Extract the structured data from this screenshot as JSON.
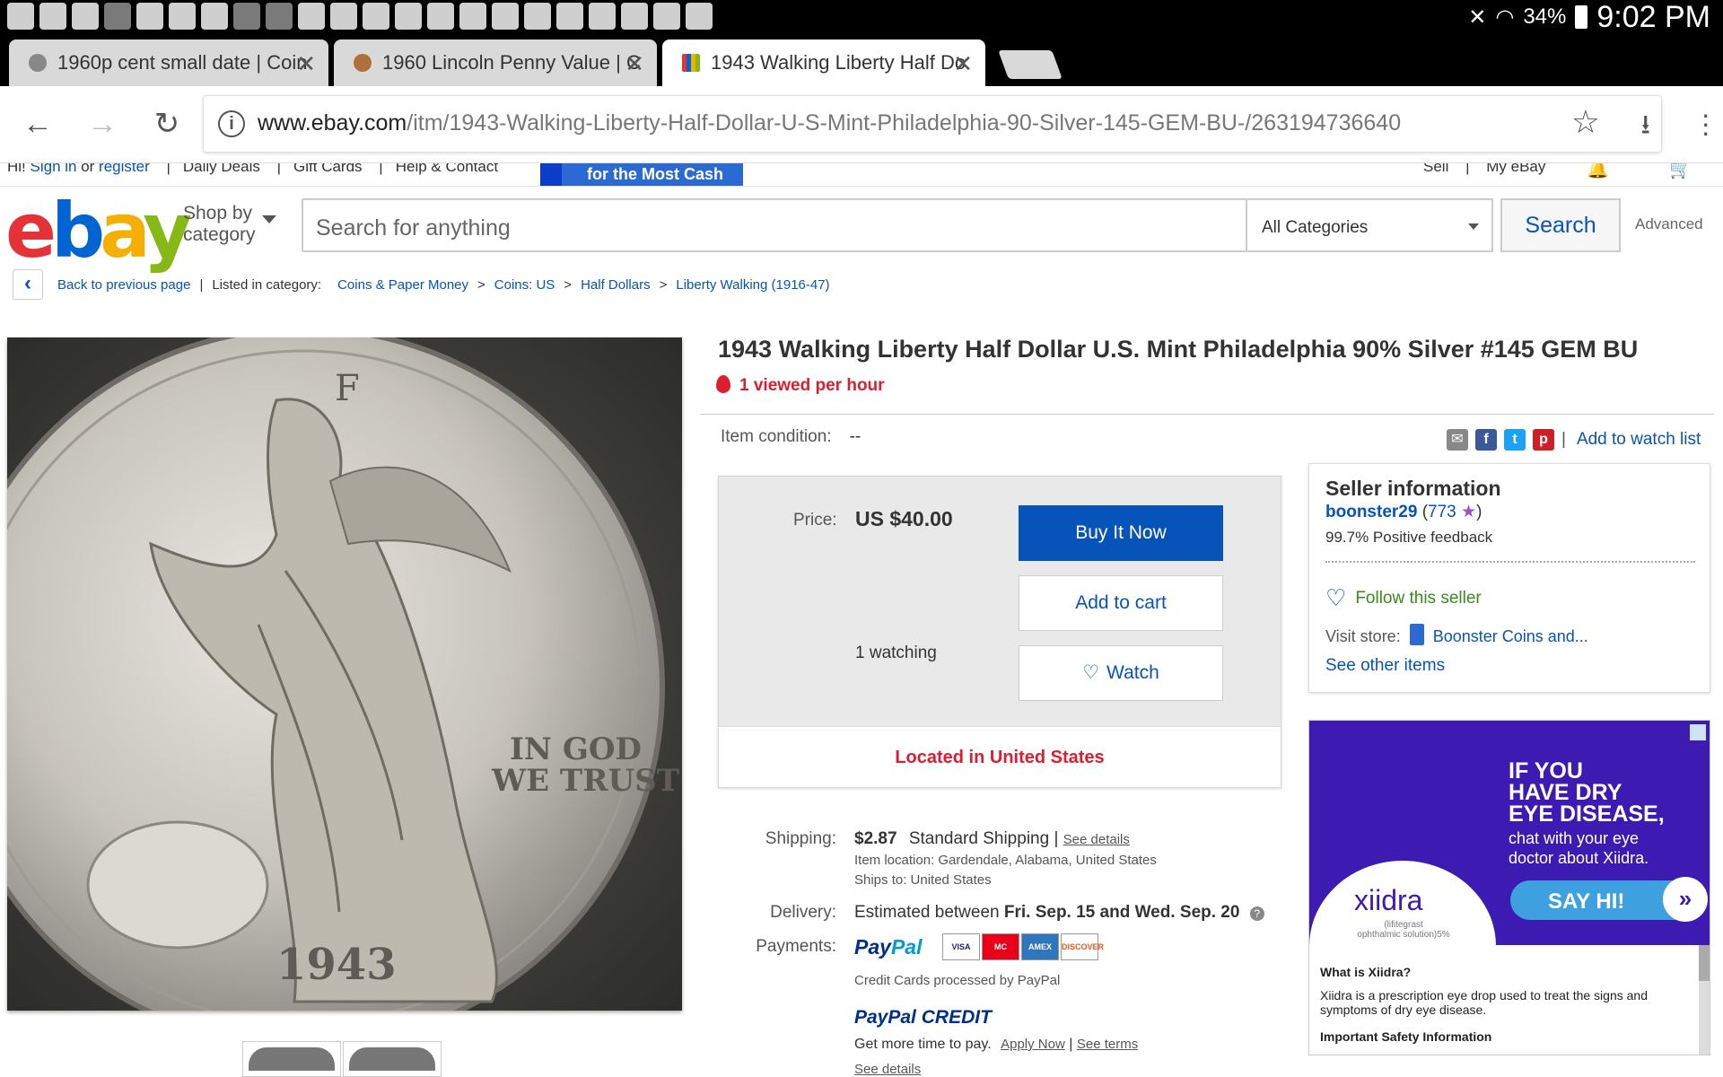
{
  "status_bar": {
    "battery": "34%",
    "time": "9:02 PM"
  },
  "tabs": [
    {
      "title": "1960p cent small date | Coin"
    },
    {
      "title": "1960 Lincoln Penny Value | C"
    },
    {
      "title": "1943 Walking Liberty Half Do"
    }
  ],
  "toolbar": {
    "url_host": "www.ebay.com",
    "url_path": "/itm/1943-Walking-Liberty-Half-Dollar-U-S-Mint-Philadelphia-90-Silver-145-GEM-BU-/263194736640"
  },
  "ebay_nav": {
    "greeting": "Hi! ",
    "sign_in": "Sign in",
    "or": " or ",
    "register": "register",
    "daily_deals": "Daily Deals",
    "gift_cards": "Gift Cards",
    "help": "Help & Contact",
    "promo": "for the Most Cash",
    "sell": "Sell",
    "my_ebay": "My eBay"
  },
  "header": {
    "logo": {
      "e": "e",
      "b": "b",
      "a": "a",
      "y": "y"
    },
    "shop_by_1": "Shop by",
    "shop_by_2": "category",
    "search_placeholder": "Search for anything",
    "category": "All Categories",
    "search_button": "Search",
    "advanced": "Advanced"
  },
  "breadcrumb": {
    "back": "Back to previous page",
    "listed": "Listed in category:",
    "items": [
      "Coins & Paper Money",
      "Coins: US",
      "Half Dollars",
      "Liberty Walking (1916-47)"
    ]
  },
  "coin": {
    "date": "1943",
    "motto_1": "IN GOD",
    "motto_2": "WE TRUST",
    "mint_mark": "F"
  },
  "item": {
    "title": "1943 Walking Liberty Half Dollar U.S. Mint Philadelphia 90% Silver #145 GEM BU",
    "viewed": "1 viewed per hour",
    "condition_label": "Item condition:",
    "condition_value": "--",
    "add_to_watch": "Add to watch list"
  },
  "buy_box": {
    "price_label": "Price:",
    "price": "US $40.00",
    "buy_now": "Buy It Now",
    "add_to_cart": "Add to cart",
    "watching": "1 watching",
    "watch": "Watch",
    "location": "Located in United States"
  },
  "shipping": {
    "label": "Shipping:",
    "cost": "$2.87",
    "method": "Standard Shipping",
    "details": "See details",
    "item_location": "Item location:  Gardendale, Alabama, United States",
    "ships_to": "Ships to:  United States"
  },
  "delivery": {
    "label": "Delivery:",
    "prefix": "Estimated between ",
    "dates": "Fri. Sep. 15 and Wed. Sep. 20"
  },
  "payments": {
    "label": "Payments:",
    "paypal_pay": "Pay",
    "paypal_pal": "Pal",
    "cards": [
      "VISA",
      "MC",
      "AMEX",
      "DISCOVER"
    ],
    "processed": "Credit Cards processed by PayPal",
    "credit_pay": "PayPal",
    "credit_word": "CREDIT",
    "more_time": "Get more time to pay.",
    "apply": "Apply Now",
    "terms": "See terms",
    "see_details": "See details"
  },
  "seller": {
    "heading": "Seller information",
    "name": "boonster29",
    "feedback": "773",
    "positive": "99.7% Positive feedback",
    "follow": "Follow this seller",
    "visit_label": "Visit store:",
    "store": "Boonster Coins and...",
    "other": "See other items"
  },
  "ad": {
    "head_1": "IF YOU",
    "head_2": "HAVE DRY",
    "head_3": "EYE DISEASE,",
    "sub_1": "chat with your eye",
    "sub_2": "doctor about Xiidra.",
    "say_hi": "SAY HI!",
    "brand": "xiidra",
    "brand_sub_1": "(lifitegrast",
    "brand_sub_2": "ophthalmic solution)5%",
    "q": "What is Xiidra?",
    "desc": "Xiidra is a prescription eye drop used to treat the signs and symptoms of dry eye disease.",
    "safety": "Important Safety Information"
  }
}
